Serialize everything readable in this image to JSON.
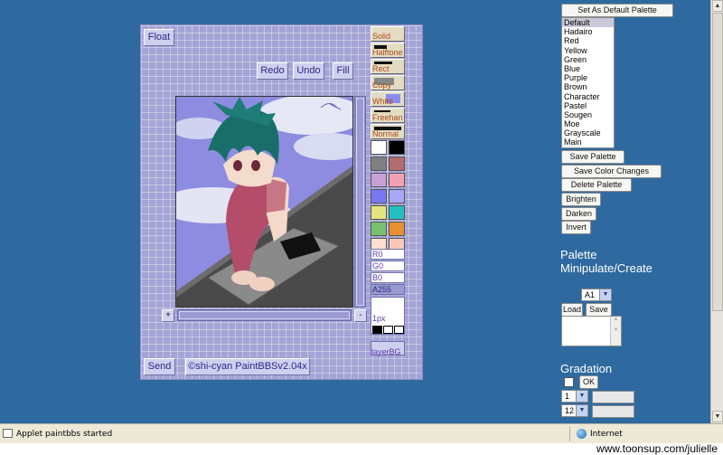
{
  "applet": {
    "float_label": "Float",
    "redo_label": "Redo",
    "undo_label": "Undo",
    "fill_label": "Fill",
    "send_label": "Send",
    "credit_label": "©shi-cyan PaintBBSv2.04x",
    "scroll_plus": "+",
    "scroll_minus": "-",
    "tools": [
      "Solid",
      "Halftone",
      "Rect",
      "Copy",
      "White",
      "Freehan",
      "Normal"
    ],
    "swatches": [
      [
        "#ffffff",
        "#000000"
      ],
      [
        "#808080",
        "#b06e6e"
      ],
      [
        "#c8a0d8",
        "#f4a0b4"
      ],
      [
        "#7878f0",
        "#a8a8f8"
      ],
      [
        "#e4e480",
        "#20c0c0"
      ],
      [
        "#78c070",
        "#e89030"
      ],
      [
        "#fde0d0",
        "#f8c8b8"
      ]
    ],
    "rgb": {
      "r": "R0",
      "g": "G0",
      "b": "B0",
      "a": "A255"
    },
    "pen_size": "1px",
    "layer_label": "layerBG"
  },
  "palette": {
    "set_default_label": "Set As Default Palette",
    "items": [
      "Default",
      "Hadairo",
      "Red",
      "Yellow",
      "Green",
      "Blue",
      "Purple",
      "Brown",
      "Character",
      "Pastel",
      "Sougen",
      "Moe",
      "Grayscale",
      "Main"
    ],
    "selected": "Default",
    "save_palette": "Save Palette",
    "save_color_changes": "Save Color Changes",
    "delete_palette": "Delete Palette",
    "brighten": "Brighten",
    "darken": "Darken",
    "invert": "Invert",
    "heading_line1": "Palette",
    "heading_line2": "Minipulate/Create",
    "slot_select": "A1",
    "load": "Load",
    "save": "Save"
  },
  "gradation": {
    "heading": "Gradation",
    "ok": "OK",
    "select1": "1",
    "select2": "12"
  },
  "status": {
    "text": "Applet paintbbs started",
    "zone": "Internet"
  },
  "credit": "www.toonsup.com/julielle"
}
